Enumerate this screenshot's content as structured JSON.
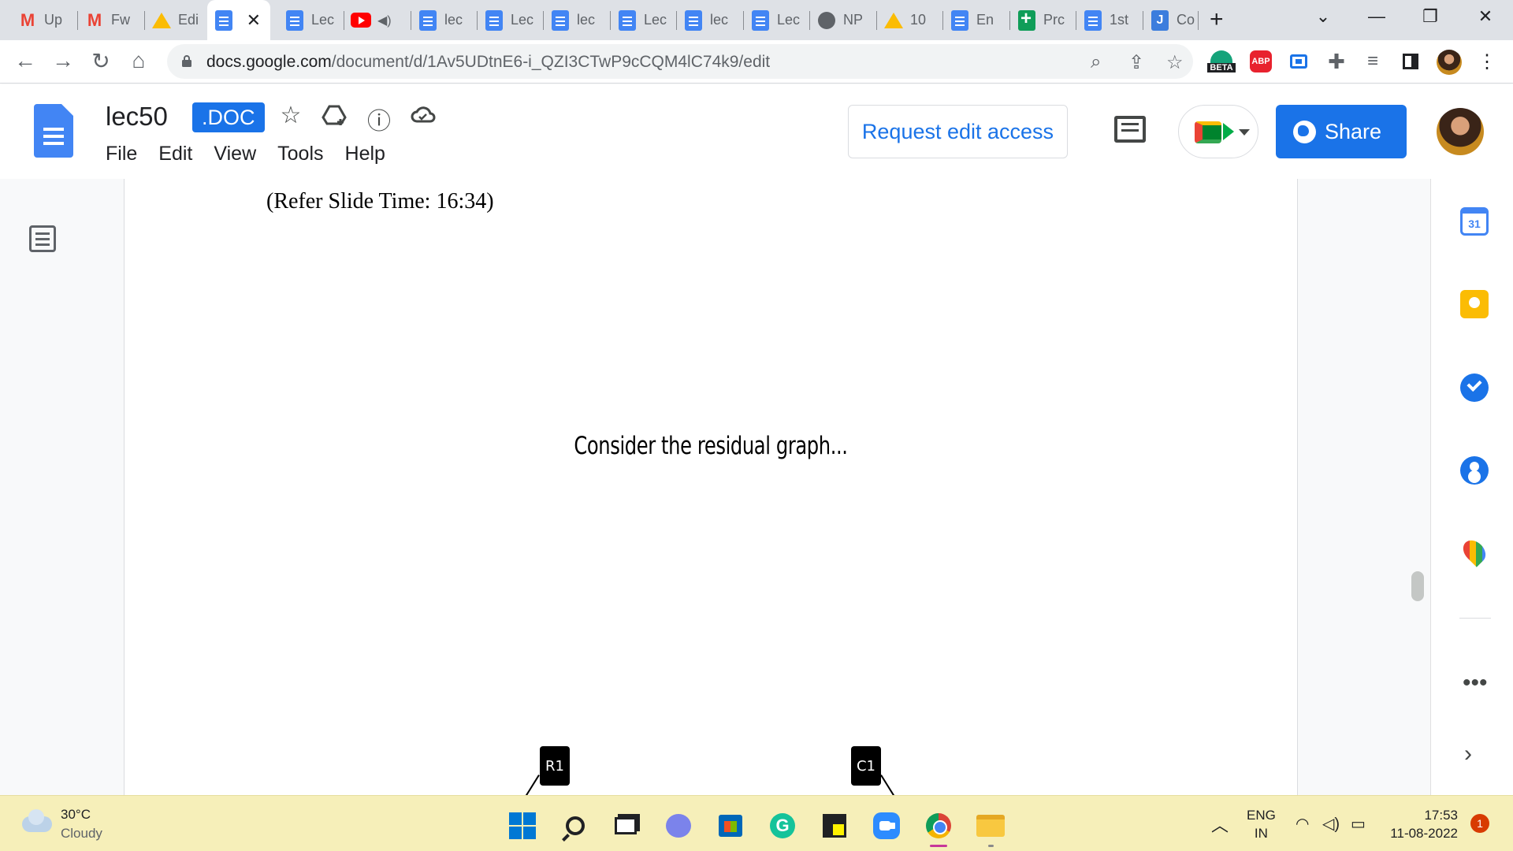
{
  "browser": {
    "tabs": [
      {
        "label": "Up",
        "icon": "gmail-icon"
      },
      {
        "label": "Fw",
        "icon": "gmail-icon"
      },
      {
        "label": "Edi",
        "icon": "google-drive-icon"
      },
      {
        "label": "",
        "icon": "google-docs-icon",
        "active": true
      },
      {
        "label": "Lec",
        "icon": "google-docs-icon"
      },
      {
        "label": "",
        "icon": "youtube-icon",
        "audio": true
      },
      {
        "label": "lec",
        "icon": "google-docs-icon"
      },
      {
        "label": "Lec",
        "icon": "google-docs-icon"
      },
      {
        "label": "lec",
        "icon": "google-docs-icon"
      },
      {
        "label": "Lec",
        "icon": "google-docs-icon"
      },
      {
        "label": "lec",
        "icon": "google-docs-icon"
      },
      {
        "label": "Lec",
        "icon": "google-docs-icon"
      },
      {
        "label": "NP",
        "icon": "globe-icon"
      },
      {
        "label": "10",
        "icon": "google-drive-icon"
      },
      {
        "label": "En",
        "icon": "google-docs-icon"
      },
      {
        "label": "Prc",
        "icon": "google-sheets-icon"
      },
      {
        "label": "1st",
        "icon": "google-docs-icon"
      },
      {
        "label": "Co",
        "icon": "jamboard-icon"
      }
    ],
    "active_tab_close": "✕",
    "new_tab": "+",
    "url_host": "docs.google.com",
    "url_path": "/document/d/1Av5UDtnE6-i_QZI3CTwP9cCQM4lC74k9/edit",
    "ext_beta": "BETA",
    "ext_abp": "ABP"
  },
  "docs": {
    "title": "lec50",
    "badge": ".DOC",
    "menu": [
      "File",
      "Edit",
      "View",
      "Tools",
      "Help"
    ],
    "request_edit": "Request edit access",
    "share": "Share"
  },
  "document": {
    "slide_time": "(Refer Slide Time: 16:34)",
    "slide_text": "Consider the residual graph...",
    "node_left": "R1",
    "node_right": "C1"
  },
  "side_panel": {
    "calendar_day": "31",
    "more": "•••",
    "expand": "›"
  },
  "taskbar": {
    "temperature": "30°C",
    "condition": "Cloudy",
    "lang_top": "ENG",
    "lang_bottom": "IN",
    "time": "17:53",
    "date": "11-08-2022",
    "notifications": "1"
  },
  "colors": {
    "accent": "#1a73e8",
    "taskbar": "#f6efb9",
    "tabstrip": "#dee1e6"
  }
}
